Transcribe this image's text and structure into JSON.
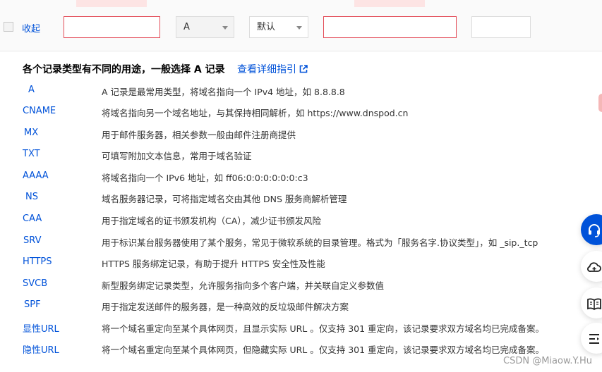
{
  "edit_row": {
    "collapse_label": "收起",
    "record_type_value": "A",
    "line_value": "默认",
    "host_value": "",
    "record_value": "",
    "ttl_value": ""
  },
  "help": {
    "title": "各个记录类型有不同的用途，一般选择 A 记录",
    "guide_link": "查看详细指引",
    "records": [
      {
        "type": "A",
        "desc": "A 记录是最常用类型，将域名指向一个 IPv4 地址，如 8.8.8.8"
      },
      {
        "type": "CNAME",
        "desc": "将域名指向另一个域名地址，与其保持相同解析，如 https://www.dnspod.cn"
      },
      {
        "type": "MX",
        "desc": "用于邮件服务器，相关参数一般由邮件注册商提供"
      },
      {
        "type": "TXT",
        "desc": "可填写附加文本信息，常用于域名验证"
      },
      {
        "type": "AAAA",
        "desc": "将域名指向一个 IPv6 地址，如 ff06:0:0:0:0:0:0:c3"
      },
      {
        "type": "NS",
        "desc": "域名服务器记录，可将指定域名交由其他 DNS 服务商解析管理"
      },
      {
        "type": "CAA",
        "desc": "用于指定域名的证书颁发机构（CA），减少证书颁发风险"
      },
      {
        "type": "SRV",
        "desc": "用于标识某台服务器使用了某个服务，常见于微软系统的目录管理。格式为「服务名字.协议类型」，如 _sip._tcp"
      },
      {
        "type": "HTTPS",
        "desc": "HTTPS 服务绑定记录，有助于提升 HTTPS 安全性及性能"
      },
      {
        "type": "SVCB",
        "desc": "新型服务绑定记录类型，允许服务指向多个客户端，并关联自定义参数值"
      },
      {
        "type": "SPF",
        "desc": "用于指定发送邮件的服务器，是一种高效的反垃圾邮件解决方案"
      },
      {
        "type": "显性URL",
        "desc": "将一个域名重定向至某个具体网页，且显示实际 URL 。仅支持 301 重定向，该记录要求双方域名均已完成备案。"
      },
      {
        "type": "隐性URL",
        "desc": "将一个域名重定向至某个具体网页，但隐藏实际 URL 。仅支持 301 重定向，该记录要求双方域名均已完成备案。"
      }
    ]
  },
  "floating_buttons": [
    "headset-icon",
    "cloud-icon",
    "book-icon",
    "list-icon"
  ],
  "watermark": "CSDN @Miaow.Y.Hu",
  "colors": {
    "link": "#0052d9",
    "error_border": "#e34d59",
    "primary_fab": "#0052d9"
  }
}
